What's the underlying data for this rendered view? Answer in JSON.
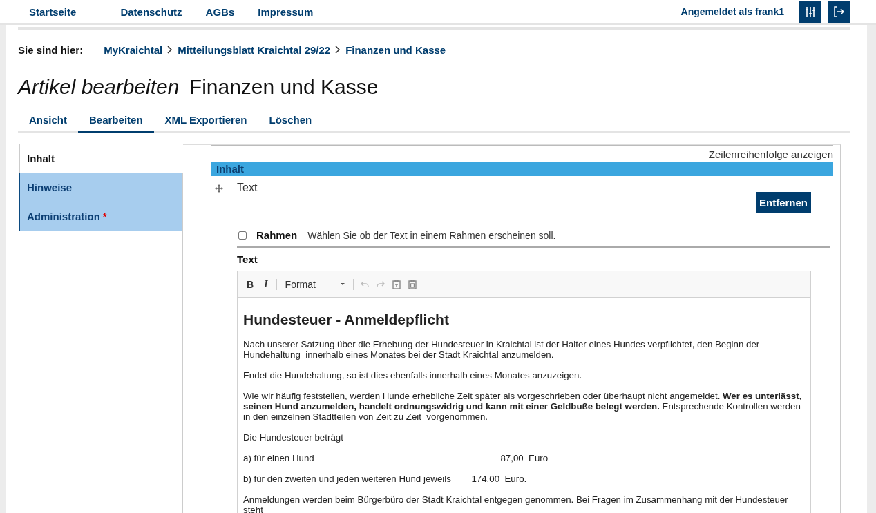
{
  "header": {
    "links": [
      {
        "label": "Startseite"
      },
      {
        "label": "Datenschutz"
      },
      {
        "label": "AGBs"
      },
      {
        "label": "Impressum"
      }
    ],
    "user_label": "Angemeldet als frank1"
  },
  "breadcrumb": {
    "label": "Sie sind hier:",
    "items": [
      {
        "label": "MyKraichtal"
      },
      {
        "label": "Mitteilungsblatt Kraichtal 29/22"
      },
      {
        "label": "Finanzen und Kasse"
      }
    ]
  },
  "title": {
    "action": "Artikel bearbeiten",
    "name": "Finanzen und Kasse"
  },
  "tabs": [
    {
      "label": "Ansicht",
      "selected": false
    },
    {
      "label": "Bearbeiten",
      "selected": true
    },
    {
      "label": "XML Exportieren",
      "selected": false
    },
    {
      "label": "Löschen",
      "selected": false
    }
  ],
  "side_tabs": [
    {
      "label": "Inhalt",
      "selected": true,
      "required": false
    },
    {
      "label": "Hinweise",
      "selected": false,
      "required": false
    },
    {
      "label": "Administration",
      "selected": false,
      "required": true,
      "required_mark": "*"
    }
  ],
  "content": {
    "row_order_link": "Zeilenreihenfolge anzeigen",
    "section_title": "Inhalt",
    "item_label": "Text",
    "remove_button": "Entfernen",
    "frame_option": {
      "label": "Rahmen",
      "hint": "Wählen Sie ob der Text in einem Rahmen erscheinen soll.",
      "checked": false
    },
    "field_label": "Text",
    "editor": {
      "toolbar": {
        "bold": "B",
        "italic": "I",
        "format": "Format"
      },
      "heading": "Hundesteuer - Anmeldepflicht",
      "paragraphs": [
        "Nach unserer Satzung über die Erhebung der Hundesteuer in Kraichtal ist der Halter eines Hundes verpflichtet, den Beginn der Hundehaltung  innerhalb eines Monates bei der Stadt Kraichtal anzumelden.",
        "Endet die Hundehaltung, so ist dies ebenfalls innerhalb eines Monates anzuzeigen.",
        "Wie wir häufig feststellen, werden Hunde erhebliche Zeit später als vorgeschrieben oder überhaupt nicht angemeldet. **Wer es unterlässt, seinen Hund anzumelden, handelt ordnungswidrig und kann mit einer Geldbuße belegt werden.** Entsprechende Kontrollen werden in den einzelnen Stadtteilen von Zeit zu Zeit  vorgenommen.",
        "Die Hundesteuer beträgt",
        "a) für einen Hund                                                                         87,00  Euro",
        "b) für den zweiten und jeden weiteren Hund jeweils        174,00  Euro.",
        "Anmeldungen werden beim Bürgerbüro der Stadt Kraichtal entgegen genommen. Bei Fragen im Zusammenhang mit der Hundesteuer steht"
      ]
    }
  }
}
